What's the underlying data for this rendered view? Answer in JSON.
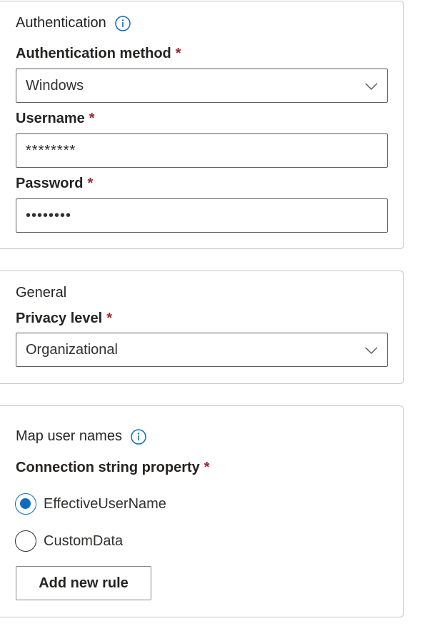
{
  "authentication": {
    "title": "Authentication",
    "method_label": "Authentication method",
    "method_value": "Windows",
    "username_label": "Username",
    "username_value": "********",
    "password_label": "Password",
    "password_value": "••••••••",
    "required_marker": "*"
  },
  "general": {
    "title": "General",
    "privacy_label": "Privacy level",
    "privacy_value": "Organizational",
    "required_marker": "*"
  },
  "map_user_names": {
    "title": "Map user names",
    "property_label": "Connection string property",
    "required_marker": "*",
    "options": [
      {
        "label": "EffectiveUserName",
        "selected": true
      },
      {
        "label": "CustomData",
        "selected": false
      }
    ],
    "add_rule_label": "Add new rule"
  },
  "icons": {
    "info": "info-icon",
    "dropdown": "chevron-down-icon"
  },
  "colors": {
    "accent": "#0f6cbd",
    "required": "#a4262c",
    "border": "#c8c6c4"
  }
}
